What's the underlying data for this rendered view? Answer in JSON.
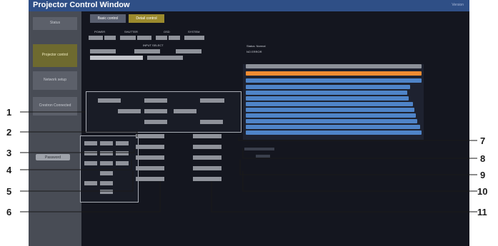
{
  "window": {
    "title": "Projector Control Window",
    "corner_text": "Version"
  },
  "sidebar": {
    "items": [
      {
        "label": "Status",
        "active": false
      },
      {
        "label": "Projector control",
        "active": true
      },
      {
        "label": "Network setup",
        "active": false
      },
      {
        "label": "Crestron Connected",
        "active": false
      }
    ],
    "bottom_button": "Password"
  },
  "tabs": [
    {
      "label": "Basic control",
      "active": false
    },
    {
      "label": "Detail control",
      "active": true
    }
  ],
  "controls": {
    "group_labels": [
      "POWER",
      "SHUTTER",
      "OSD",
      "SYSTEM"
    ],
    "input_select_label": "INPUT SELECT"
  },
  "status_header": {
    "line1": "Status: Normal",
    "line2": "NO ERROR"
  },
  "callouts": [
    "1",
    "2",
    "3",
    "4",
    "5",
    "6",
    "7",
    "8",
    "9",
    "10",
    "11"
  ],
  "colors": {
    "window_bg": "#14161f",
    "titlebar": "#2f4f86",
    "sidebar": "#484c55",
    "active_tab": "#9b8a2d",
    "log_line": "#4f84c8",
    "log_highlight": "#f08c32"
  }
}
